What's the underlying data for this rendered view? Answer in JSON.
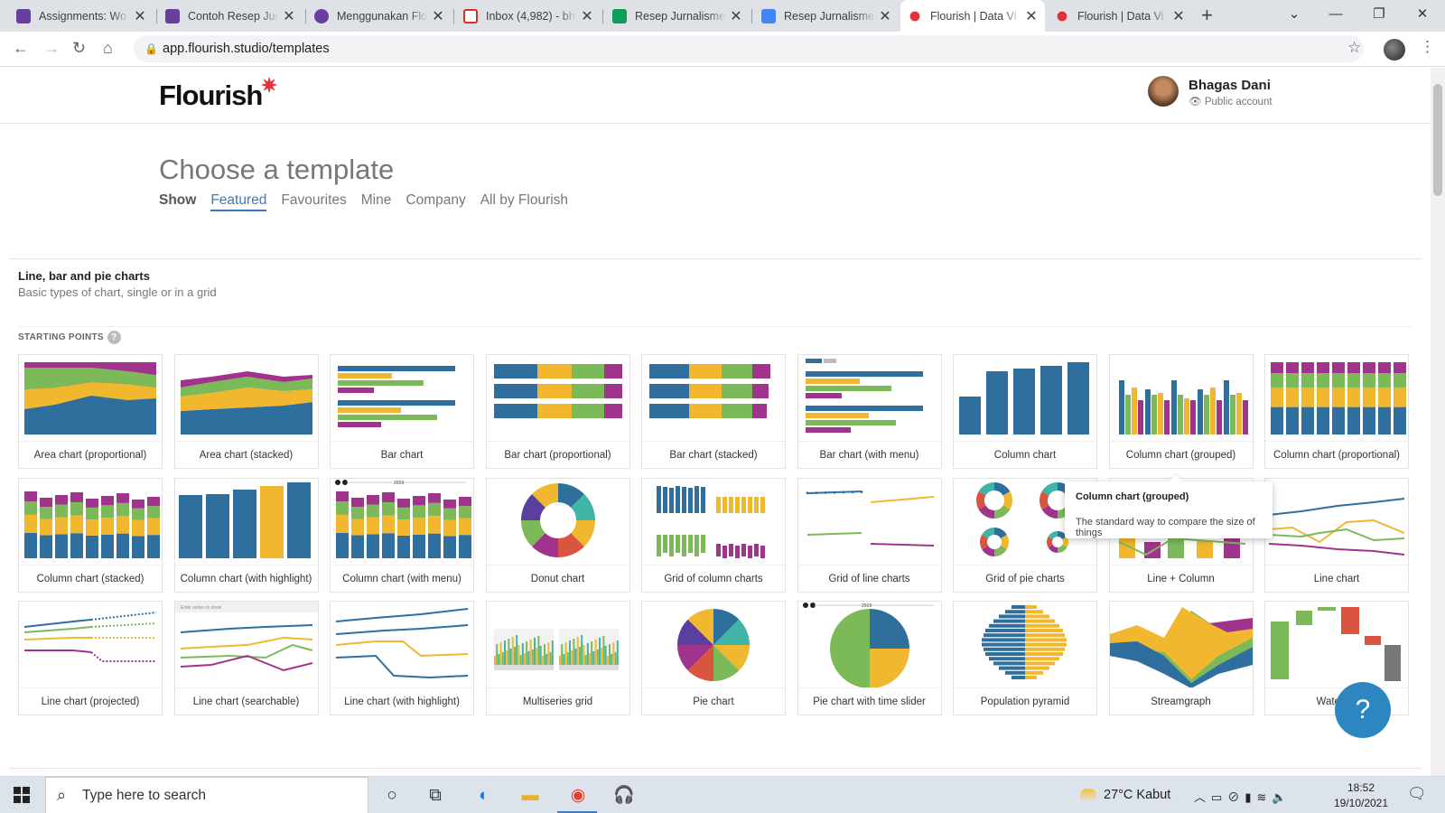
{
  "browser": {
    "tabs": [
      {
        "title": "Assignments: Wo",
        "icon_color": "#6a3ea1"
      },
      {
        "title": "Contoh Resep Jur",
        "icon_color": "#6a3ea1"
      },
      {
        "title": "Menggunakan Flo",
        "icon_color": "#6a3ea1"
      },
      {
        "title": "Inbox (4,982) - bh",
        "icon_color": "#d93025"
      },
      {
        "title": "Resep Jurnalisme",
        "icon_color": "#0f9d58"
      },
      {
        "title": "Resep Jurnalisme",
        "icon_color": "#4285f4"
      },
      {
        "title": "Flourish | Data Vi",
        "icon_color": "#e8303a"
      },
      {
        "title": "Flourish | Data Vi",
        "icon_color": "#e8303a"
      }
    ],
    "url": "app.flourish.studio/templates"
  },
  "header": {
    "logo": "Flourish",
    "user_name": "Bhagas Dani",
    "account_type": "Public account"
  },
  "main": {
    "title": "Choose a template",
    "filter_label": "Show",
    "filters": [
      "Featured",
      "Favourites",
      "Mine",
      "Company",
      "All by Flourish"
    ],
    "active_filter": "Featured",
    "section_title": "Line, bar and pie charts",
    "section_subtitle": "Basic types of chart, single or in a grid",
    "starting_points_label": "STARTING POINTS",
    "help_mark": "?",
    "templates_row1": [
      "Area chart (proportional)",
      "Area chart (stacked)",
      "Bar chart",
      "Bar chart (proportional)",
      "Bar chart (stacked)",
      "Bar chart (with menu)",
      "Column chart",
      "Column chart (grouped)",
      "Column chart (proportional)"
    ],
    "templates_row2": [
      "Column chart (stacked)",
      "Column chart (with highlight)",
      "Column chart (with menu)",
      "Donut chart",
      "Grid of column charts",
      "Grid of line charts",
      "Grid of pie charts",
      "Line + Column",
      "Line chart"
    ],
    "templates_row3": [
      "Line chart (projected)",
      "Line chart (searchable)",
      "Line chart (with highlight)",
      "Multiseries grid",
      "Pie chart",
      "Pie chart with time slider",
      "Population pyramid",
      "Streamgraph",
      "Waterfall"
    ],
    "tooltip": {
      "title": "Column chart (grouped)",
      "description": "The standard way to compare the size of things"
    },
    "help_button": "?"
  },
  "thumb_text": {
    "year_label": "2019",
    "searchable_hint": "Enter series to show"
  },
  "colors": {
    "blue": "#2e6f9e",
    "yellow": "#f1b72e",
    "green": "#7cba59",
    "purple": "#a0348d",
    "red": "#d9553f",
    "teal": "#3fb4a7",
    "accent_link": "#3b79b8"
  },
  "taskbar": {
    "search_placeholder": "Type here to search",
    "weather": "27°C  Kabut",
    "time": "18:52",
    "date": "19/10/2021"
  }
}
